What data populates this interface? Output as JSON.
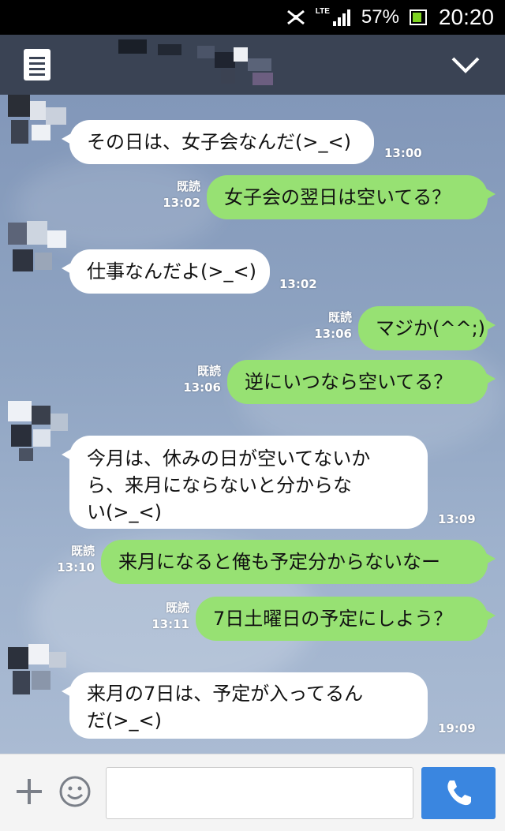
{
  "status_bar": {
    "network": "LTE",
    "battery": "57%",
    "time": "20:20",
    "icons": [
      "wifi-off-icon",
      "signal-icon",
      "battery-icon"
    ]
  },
  "header": {
    "menu_icon": "list-menu-icon",
    "chevron_icon": "chevron-down-icon"
  },
  "messages": [
    {
      "side": "in",
      "text": "その日は、女子会なんだ(>_<)",
      "time": "13:00"
    },
    {
      "side": "out",
      "text": "女子会の翌日は空いてる？",
      "read": "既読",
      "time": "13:02"
    },
    {
      "side": "in",
      "text": "仕事なんだよ(>_<)",
      "time": "13:02"
    },
    {
      "side": "out",
      "text": "マジか(^^;)",
      "read": "既読",
      "time": "13:06"
    },
    {
      "side": "out",
      "text": "逆にいつなら空いてる？",
      "read": "既読",
      "time": "13:06"
    },
    {
      "side": "in",
      "lines": [
        "今月は、休みの日が空いてないか",
        "ら、来月にならないと分からな",
        "い(>_<)"
      ],
      "time": "13:09"
    },
    {
      "side": "out",
      "text": "来月になると俺も予定分からないなー",
      "read": "既読",
      "time": "13:10"
    },
    {
      "side": "out",
      "text": "7日土曜日の予定にしよう？",
      "read": "既読",
      "time": "13:11"
    },
    {
      "side": "in",
      "lines": [
        "来月の7日は、予定が入ってるん",
        "だ(>_<)"
      ],
      "time": "19:09"
    }
  ],
  "input_bar": {
    "placeholder": "",
    "icons": [
      "plus-icon",
      "emoji-icon",
      "phone-icon"
    ]
  },
  "colors": {
    "header_bg": "#3a4354",
    "chat_bg": "#8fa4c2",
    "outgoing_bubble": "#97e173",
    "incoming_bubble": "#ffffff",
    "call_button": "#3a86e0"
  }
}
